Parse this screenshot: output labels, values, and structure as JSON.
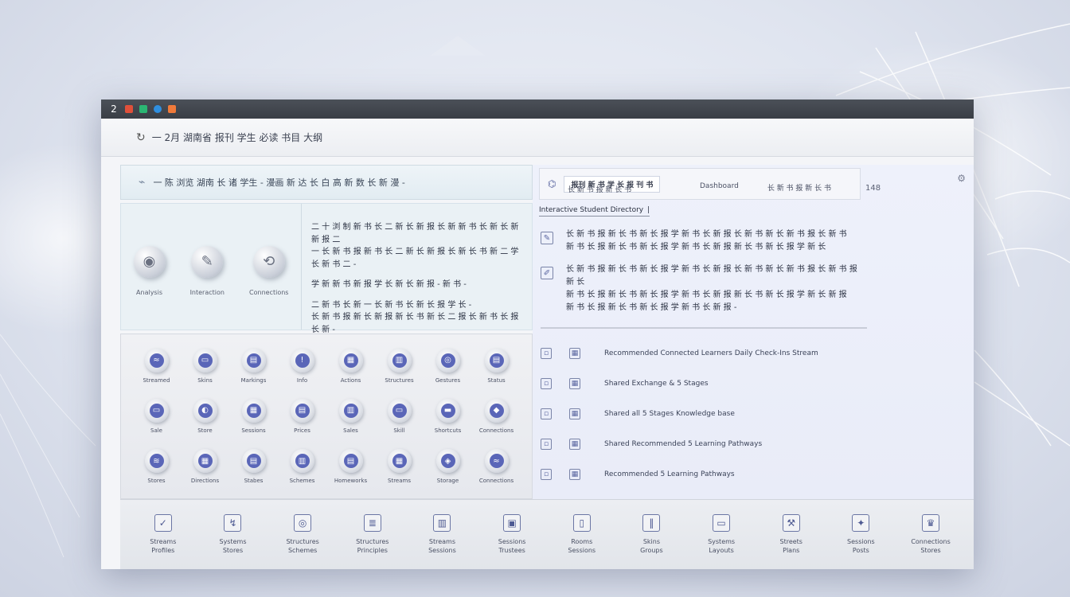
{
  "titlebar": {
    "glyph": "2",
    "colors": [
      "#e0503a",
      "#2bb673",
      "#2f8fe0",
      "#f07a3a"
    ]
  },
  "toolbar": {
    "refresh_icon": "refresh-icon",
    "title": "一 2月 湖南省 报刊 学生 必读 书目 大纲"
  },
  "left_header": {
    "icon": "document-icon",
    "text": "一 陈 浏览 湖南 长 诸 学生 - 漫画     新 达 长 白 高 新 数 长 新 漫 -"
  },
  "features": [
    {
      "label": "Analysis",
      "icon": "disc-icon",
      "glyph": "◉"
    },
    {
      "label": "Interaction",
      "icon": "pen-icon",
      "glyph": "✎"
    },
    {
      "label": "Connections",
      "icon": "link-icon",
      "glyph": "⟲"
    }
  ],
  "feature_text": [
    "二 十 浏 制 新 书 长 二 新 长 新 报 长 新 新 书 长 新 长 新 新 报 二\n一 长 新 书 报 新 书 长 二 新 长 新 报 长 新 长 书 新 二 学 长 新 书 二 -",
    "学 新 新 书 新 报 学 长 新 长 新 报 - 新 书 -",
    "二 新 书 长 新 一 长 新 书 长 新 长 报 学 长 -\n长 新 书 报 新 长 新 报 新 长 书 新 长 二 报 长 新 书 长 报 长 新 -"
  ],
  "grid": [
    {
      "label": "Streamed",
      "glyph": "≈"
    },
    {
      "label": "Skins",
      "glyph": "▭"
    },
    {
      "label": "Markings",
      "glyph": "▤"
    },
    {
      "label": "Info",
      "glyph": "!"
    },
    {
      "label": "Actions",
      "glyph": "▦"
    },
    {
      "label": "Structures",
      "glyph": "▥"
    },
    {
      "label": "Gestures",
      "glyph": "◎"
    },
    {
      "label": "Status",
      "glyph": "▤"
    },
    {
      "label": "Sale",
      "glyph": "▭"
    },
    {
      "label": "Store",
      "glyph": "◐"
    },
    {
      "label": "Sessions",
      "glyph": "▦"
    },
    {
      "label": "Prices",
      "glyph": "▤"
    },
    {
      "label": "Sales",
      "glyph": "▥"
    },
    {
      "label": "Skill",
      "glyph": "▭"
    },
    {
      "label": "Shortcuts",
      "glyph": "▬"
    },
    {
      "label": "Connections",
      "glyph": "◆"
    },
    {
      "label": "Stores",
      "glyph": "≋"
    },
    {
      "label": "Directions",
      "glyph": "▦"
    },
    {
      "label": "Stabes",
      "glyph": "▤"
    },
    {
      "label": "Schemes",
      "glyph": "▥"
    },
    {
      "label": "Homeworks",
      "glyph": "▤"
    },
    {
      "label": "Streams",
      "glyph": "▦"
    },
    {
      "label": "Storage",
      "glyph": "◈"
    },
    {
      "label": "Connections",
      "glyph": "≈"
    }
  ],
  "right_header": {
    "title": "报刊 新 书 学 长 报 刊 书",
    "meta": "长 新 书 报 新 长 书",
    "tabs": [
      "Dashboard",
      "长 新 书 报 新 长 书"
    ],
    "number": "148",
    "settings_icon": "settings-icon",
    "badge_icon": "tag-icon"
  },
  "search": {
    "text": "Interactive Student Directory"
  },
  "descriptions": [
    {
      "icon": "edit-icon",
      "glyph": "✎",
      "text": "长 新 书 报 新 长 书 新 长 报 学 新 书 长 新 报 长 新 书 新 长 新 书 报 长 新 书\n新 书 长 报 新 长 书 新 长 报 学 新 书 长 新 报 新 长 书 新 长 报 学 新 长"
    },
    {
      "icon": "pen-square-icon",
      "glyph": "✐",
      "text": "长 新 书 报 新 长 书 新 长 报 学 新 书 长 新 报 长 新 书 新 长 新 书 报 长 新 书 报 新 长\n新 书 长 报 新 长 书 新 长 报 学 新 书 长 新 报 新 长 书 新 长 报 学 新 长 新 报\n新 书 长 报 新 长 书 新 长 报 学 新 书 长 新 报 -"
    }
  ],
  "list": [
    {
      "icon_a": "grid-icon",
      "icon_b": "box-icon",
      "text": "Recommended Connected Learners Daily Check-Ins Stream"
    },
    {
      "icon_a": "frame-icon",
      "icon_b": "grid-icon",
      "text": "Shared Exchange & 5 Stages"
    },
    {
      "icon_a": "frame-icon",
      "icon_b": "grid-icon",
      "text": "Shared all 5 Stages Knowledge base"
    },
    {
      "icon_a": "frame-icon",
      "icon_b": "grid-icon",
      "text": "Shared Recommended 5 Learning Pathways"
    },
    {
      "icon_a": "frame-icon",
      "icon_b": "grid-icon",
      "text": "Recommended 5 Learning Pathways"
    }
  ],
  "bottom_bar": [
    {
      "label": "Streams\nProfiles",
      "icon": "check-square-icon",
      "glyph": "✓"
    },
    {
      "label": "Systems\nStores",
      "icon": "trend-icon",
      "glyph": "↯"
    },
    {
      "label": "Structures\nSchemes",
      "icon": "target-icon",
      "glyph": "◎"
    },
    {
      "label": "Structures\nPrinciples",
      "icon": "layers-icon",
      "glyph": "≣"
    },
    {
      "label": "Streams\nSessions",
      "icon": "columns-icon",
      "glyph": "▥"
    },
    {
      "label": "Sessions\nTrustees",
      "icon": "clipboard-icon",
      "glyph": "▣"
    },
    {
      "label": "Rooms\nSessions",
      "icon": "panel-icon",
      "glyph": "▯"
    },
    {
      "label": "Skins\nGroups",
      "icon": "bars-icon",
      "glyph": "‖"
    },
    {
      "label": "Systems\nLayouts",
      "icon": "monitor-icon",
      "glyph": "▭"
    },
    {
      "label": "Streets\nPlans",
      "icon": "tool-icon",
      "glyph": "⚒"
    },
    {
      "label": "Sessions\nPosts",
      "icon": "tags-icon",
      "glyph": "✦"
    },
    {
      "label": "Connections\nStores",
      "icon": "crown-icon",
      "glyph": "♛"
    }
  ]
}
